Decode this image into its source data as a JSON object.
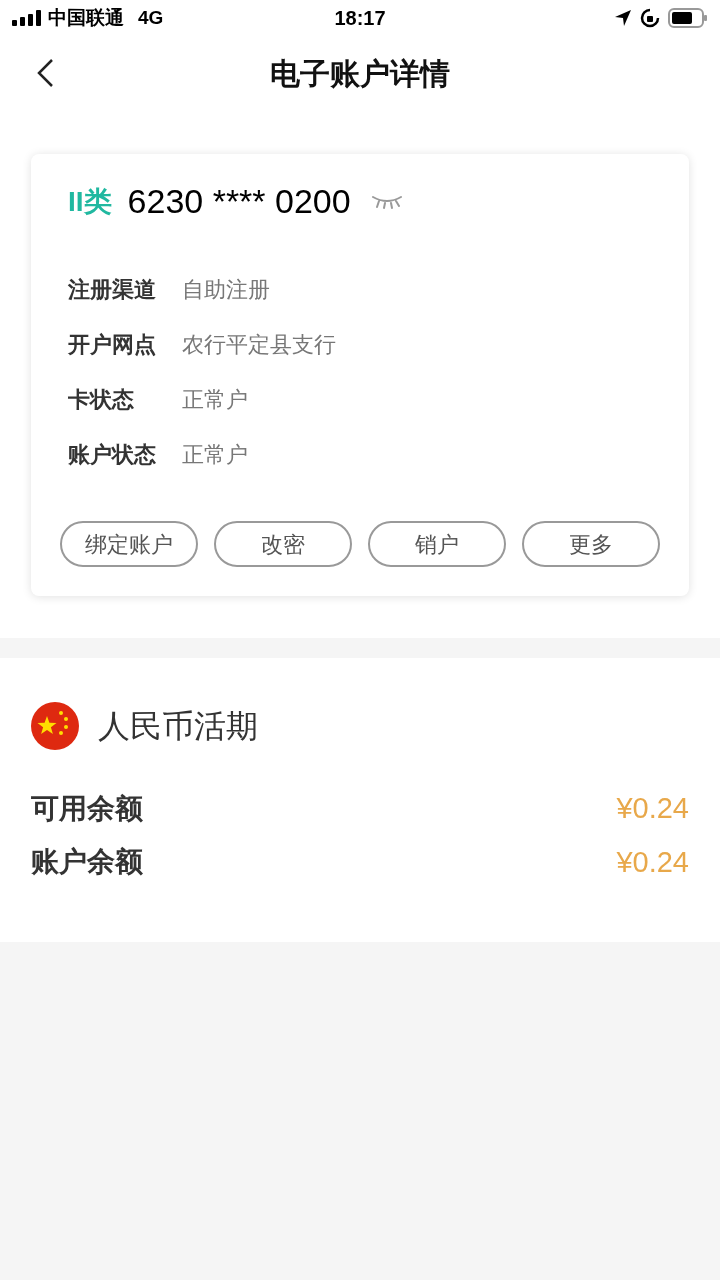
{
  "status_bar": {
    "carrier": "中国联通",
    "network": "4G",
    "time": "18:17"
  },
  "nav": {
    "title": "电子账户详情"
  },
  "card": {
    "type_label": "II类",
    "account_number": "6230 **** 0200",
    "fields": [
      {
        "label": "注册渠道",
        "value": "自助注册"
      },
      {
        "label": "开户网点",
        "value": "农行平定县支行"
      },
      {
        "label": "卡状态",
        "value": "正常户"
      },
      {
        "label": "账户状态",
        "value": "正常户"
      }
    ],
    "buttons": [
      "绑定账户",
      "改密",
      "销户",
      "更多"
    ]
  },
  "currency": {
    "title": "人民币活期",
    "balances": [
      {
        "label": "可用余额",
        "value": "¥0.24"
      },
      {
        "label": "账户余额",
        "value": "¥0.24"
      }
    ]
  }
}
